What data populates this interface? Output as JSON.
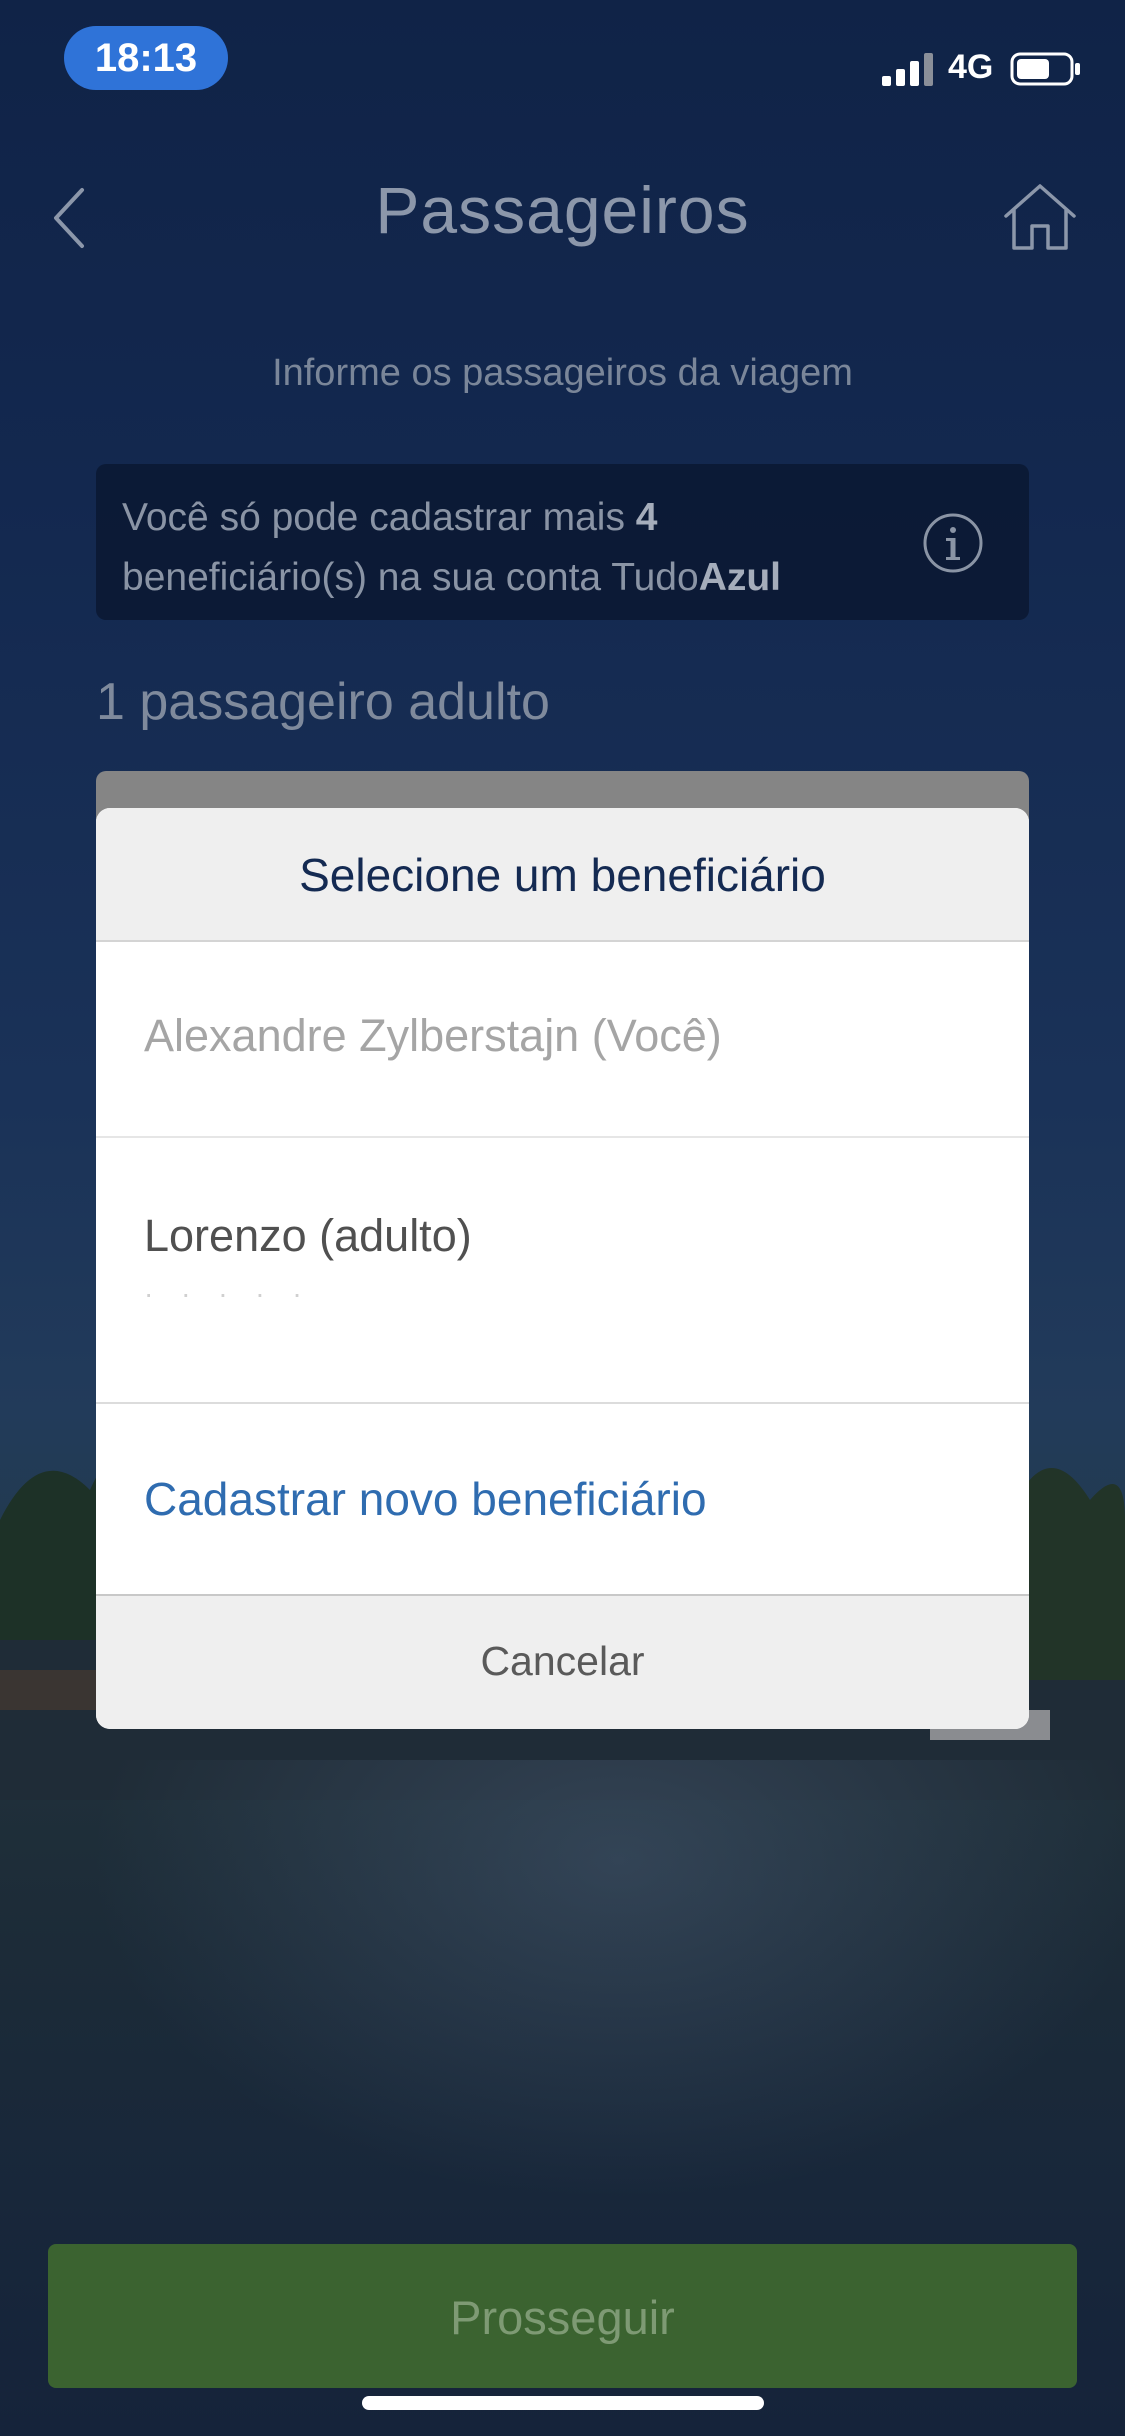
{
  "status_bar": {
    "time": "18:13",
    "network": "4G",
    "signal_bars": 3,
    "battery_level": 0.6
  },
  "header": {
    "title": "Passageiros",
    "back_icon": "chevron-left-icon",
    "home_icon": "home-icon"
  },
  "subtitle": "Informe os passageiros da viagem",
  "info_notice": {
    "prefix": "Você só pode cadastrar mais ",
    "count": "4",
    "middle": " beneficiário(s) na sua conta Tudo",
    "brand_bold": "Azul",
    "icon": "info-icon"
  },
  "passenger_section": {
    "label": "1 passageiro adulto"
  },
  "beneficiary_sheet": {
    "title": "Selecione um beneficiário",
    "options": [
      {
        "label": "Alexandre Zylberstajn (Você)",
        "disabled": true
      },
      {
        "label": "Lorenzo (adulto)",
        "sub": "· · · · ·"
      },
      {
        "label": "Cadastrar novo beneficiário",
        "action": true
      }
    ],
    "cancel_label": "Cancelar"
  },
  "footer": {
    "proceed_label": "Prosseguir"
  },
  "colors": {
    "accent_blue": "#2f73d8",
    "link_blue": "#2f6cb0",
    "proceed_green": "#3b6330",
    "title_navy": "#142a52"
  }
}
